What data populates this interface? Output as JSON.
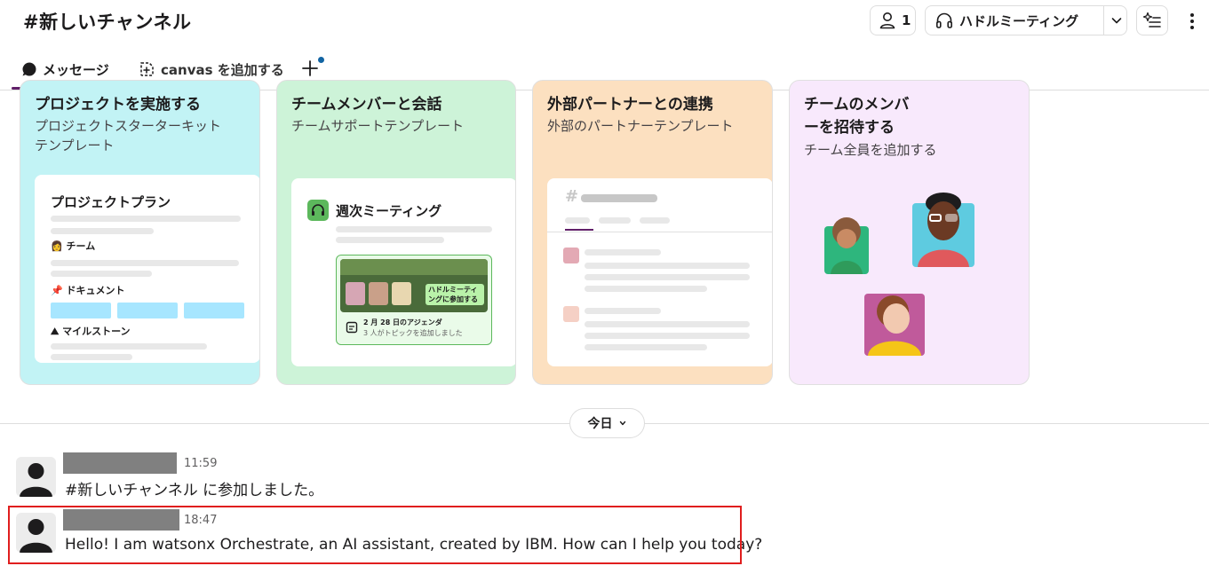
{
  "header": {
    "channel_title": "#新しいチャンネル",
    "member_count": "1",
    "huddle_label": "ハドルミーティング"
  },
  "tabs": {
    "messages_label": "メッセージ",
    "canvas_label": "canvas を追加する"
  },
  "templates": [
    {
      "title": "プロジェクトを実施する",
      "subtitle_line1": "プロジェクトスターターキット",
      "subtitle_line2": "テンプレート",
      "preview_title": "プロジェクトプラン",
      "preview_sections": [
        "チーム",
        "ドキュメント",
        "マイルストーン"
      ]
    },
    {
      "title": "チームメンバーと会話",
      "subtitle": "チームサポートテンプレート",
      "preview_title": "週次ミーティング",
      "huddle_badge": "ハドルミーティングに参加する",
      "agenda_title": "2 月 28 日のアジェンダ",
      "agenda_sub": "3 人がトピックを追加しました"
    },
    {
      "title": "外部パートナーとの連携",
      "subtitle": "外部のパートナーテンプレート",
      "preview_hash": "#"
    },
    {
      "title_line1": "チームのメンバ",
      "title_line2": "ーを招待する",
      "subtitle": "チーム全員を追加する"
    }
  ],
  "date_divider": "今日",
  "messages": [
    {
      "time": "11:59",
      "text": "#新しいチャンネル に参加しました。"
    },
    {
      "time": "18:47",
      "text": "Hello! I am watsonx Orchestrate, an AI assistant, created by IBM. How can I help you today?"
    }
  ],
  "colors": {
    "accent": "#611f69",
    "highlight": "#e01e1e",
    "card1": "#c2f3f5",
    "card2": "#cdf3d8",
    "card3": "#fce0c0",
    "card4": "#f8e9fc"
  }
}
